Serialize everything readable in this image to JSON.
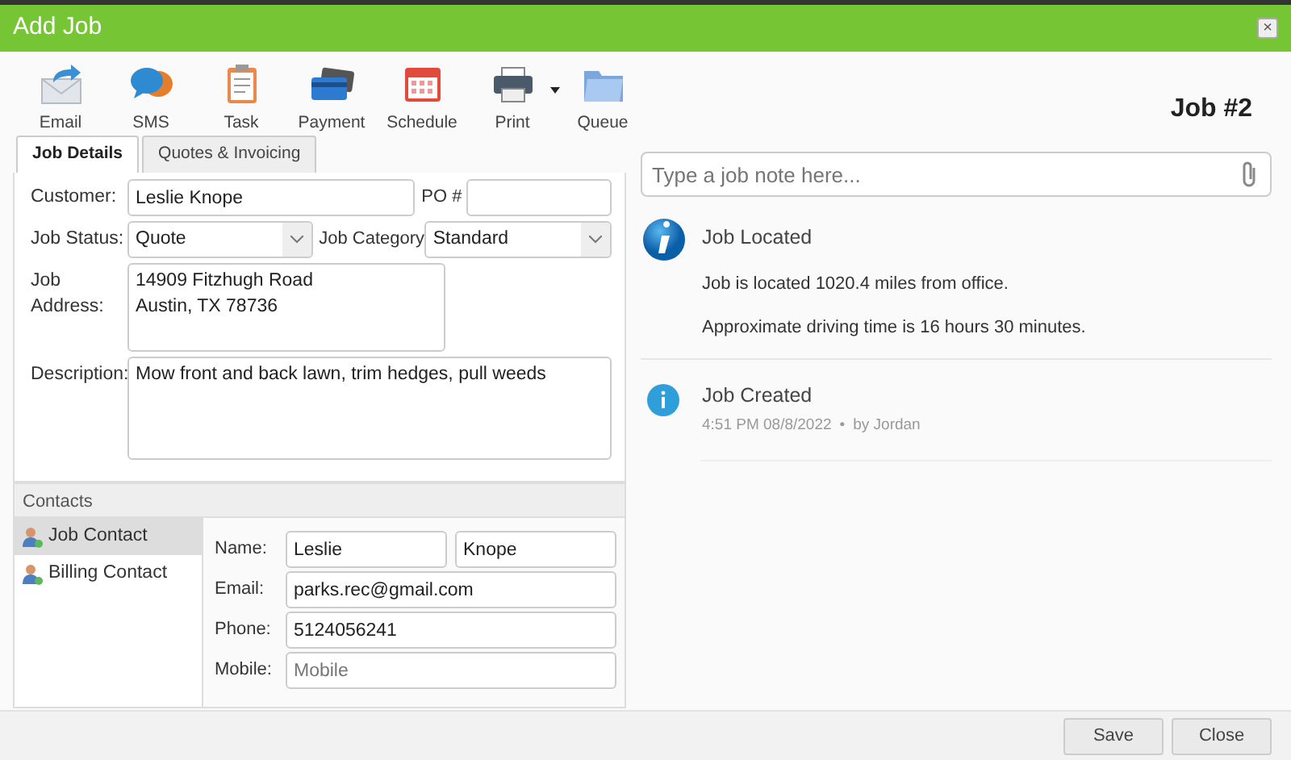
{
  "window": {
    "title": "Add Job",
    "close": "×"
  },
  "toolbar": [
    {
      "label": "Email",
      "dropdown": false
    },
    {
      "label": "SMS",
      "dropdown": false
    },
    {
      "label": "Task",
      "dropdown": false
    },
    {
      "label": "Payment",
      "dropdown": false
    },
    {
      "label": "Schedule",
      "dropdown": false
    },
    {
      "label": "Print",
      "dropdown": true
    },
    {
      "label": "Queue",
      "dropdown": false
    }
  ],
  "job_number": "Job #2",
  "tabs": [
    {
      "label": "Job Details",
      "selected": true
    },
    {
      "label": "Quotes & Invoicing",
      "selected": false
    }
  ],
  "form": {
    "customer": {
      "label": "Customer:",
      "value": "Leslie Knope"
    },
    "po": {
      "label": "PO #"
    },
    "job_status": {
      "label": "Job Status:",
      "value": "Quote"
    },
    "job_category": {
      "label": "Job Category",
      "value": "Standard"
    },
    "job_address": {
      "label": "Job Address:",
      "value": "14909 Fitzhugh Road\nAustin, TX 78736"
    },
    "description": {
      "label": "Description:",
      "value": "Mow front and back lawn, trim hedges, pull weeds"
    }
  },
  "contacts": {
    "title": "Contacts",
    "items": [
      {
        "label": "Job Contact",
        "selected": true
      },
      {
        "label": "Billing Contact",
        "selected": false
      }
    ],
    "name": {
      "label": "Name:",
      "first": "Leslie",
      "last": "Knope"
    },
    "email": {
      "label": "Email:",
      "value": "parks.rec@gmail.com"
    },
    "phone": {
      "label": "Phone:",
      "value": "5124056241"
    },
    "mobile": {
      "label": "Mobile:",
      "placeholder": "Mobile"
    }
  },
  "notes": {
    "placeholder": "Type a job note here..."
  },
  "timeline": [
    {
      "kind": "located",
      "title": "Job Located",
      "lines": [
        "Job is located 1020.4 miles from office.",
        "Approximate driving time is 16 hours 30 minutes."
      ]
    },
    {
      "kind": "created",
      "title": "Job Created",
      "time": "4:51 PM 08/8/2022",
      "separator": "•",
      "author": "by Jordan"
    }
  ],
  "buttons": [
    "Save",
    "Close"
  ]
}
